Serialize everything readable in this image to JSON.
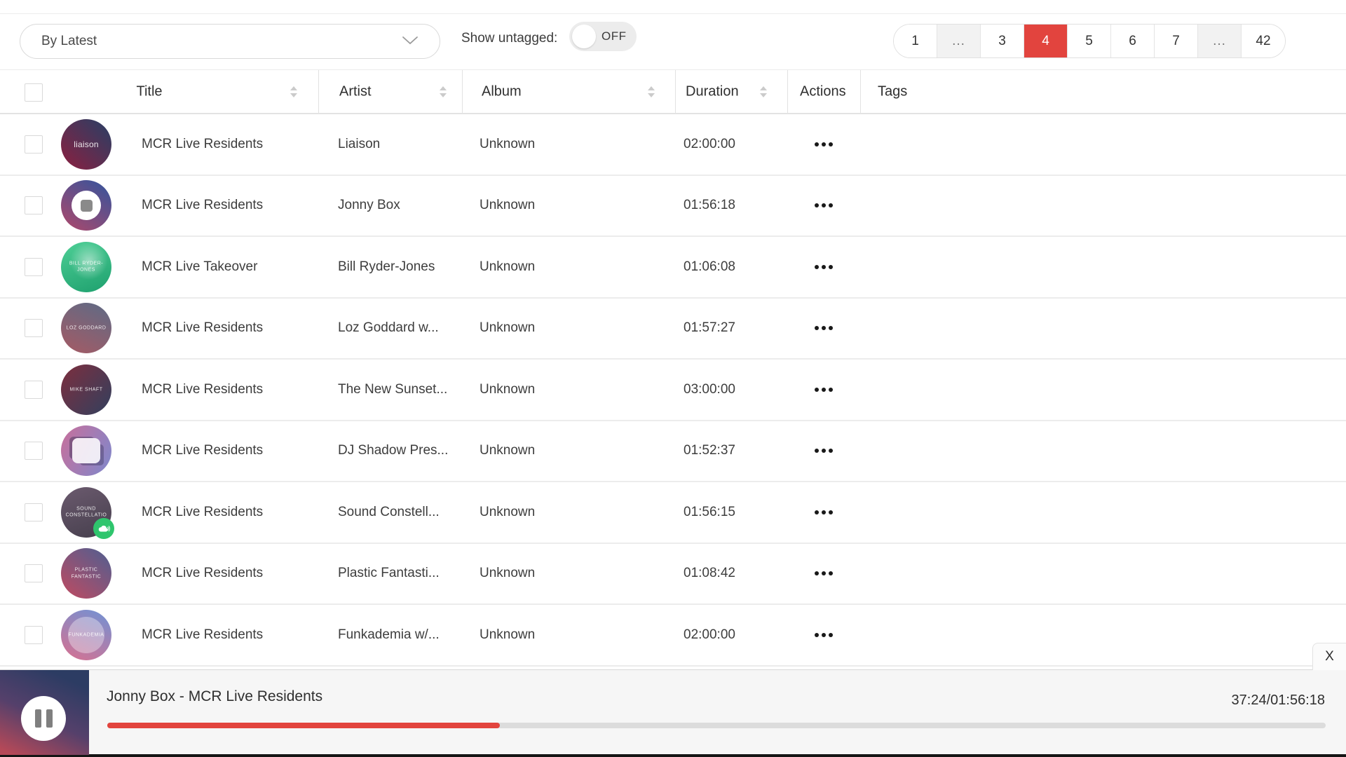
{
  "toolbar": {
    "sort": {
      "value": "By Latest"
    },
    "untagged": {
      "label": "Show untagged:",
      "state": "OFF"
    },
    "pagination": {
      "pages": [
        "1",
        "...",
        "3",
        "4",
        "5",
        "6",
        "7",
        "...",
        "42"
      ],
      "active": "4"
    }
  },
  "table": {
    "columns": [
      "Title",
      "Artist",
      "Album",
      "Duration",
      "Actions",
      "Tags"
    ],
    "sortable_columns": [
      "Title",
      "Artist",
      "Album",
      "Duration"
    ],
    "rows": [
      {
        "title": "MCR Live Residents",
        "artist": "Liaison",
        "album": "Unknown",
        "duration": "02:00:00",
        "art": {
          "label": "liaison",
          "label_large": true,
          "from": "#274066",
          "to": "#8c1f3f",
          "angle": 225
        }
      },
      {
        "title": "MCR Live Residents",
        "artist": "Jonny Box",
        "album": "Unknown",
        "duration": "01:56:18",
        "playing": true,
        "art": {
          "label": "",
          "from": "#31549e",
          "to": "#b0486a",
          "angle": 215
        }
      },
      {
        "title": "MCR Live Takeover",
        "artist": "Bill Ryder-Jones",
        "album": "Unknown",
        "duration": "01:06:08",
        "art": {
          "label": "BILL RYDER-JONES",
          "from": "#4ecf96",
          "to": "#1ea06e",
          "angle": 160,
          "highlight": true
        }
      },
      {
        "title": "MCR Live Residents",
        "artist": "Loz Goddard w...",
        "album": "Unknown",
        "duration": "01:57:27",
        "art": {
          "label": "LOZ GODDARD",
          "from": "#5d6b86",
          "to": "#a65a64",
          "angle": 205
        }
      },
      {
        "title": "MCR Live Residents",
        "artist": "The New Sunset...",
        "album": "Unknown",
        "duration": "03:00:00",
        "art": {
          "label": "MIKE SHAFT",
          "from": "#7d2e3e",
          "to": "#32405e",
          "angle": 130
        }
      },
      {
        "title": "MCR Live Residents",
        "artist": "DJ Shadow Pres...",
        "album": "Unknown",
        "duration": "01:52:37",
        "art": {
          "label": "",
          "from": "#c86f9b",
          "to": "#7e88cc",
          "angle": 115,
          "blob": true
        }
      },
      {
        "title": "MCR Live Residents",
        "artist": "Sound Constell...",
        "album": "Unknown",
        "duration": "01:56:15",
        "art": {
          "label": "SOUND CONSTELLATIO",
          "from": "#6b5a6e",
          "to": "#463f4d",
          "angle": 160,
          "badge": "soundcloud"
        }
      },
      {
        "title": "MCR Live Residents",
        "artist": "Plastic Fantasti...",
        "album": "Unknown",
        "duration": "01:08:42",
        "art": {
          "label": "PLASTIC FANTASTIC",
          "from": "#4e5f92",
          "to": "#c14a60",
          "angle": 220
        }
      },
      {
        "title": "MCR Live Residents",
        "artist": "Funkademia w/...",
        "album": "Unknown",
        "duration": "02:00:00",
        "art": {
          "label": "funkademia",
          "from": "#6f93d6",
          "to": "#d9708f",
          "angle": 205,
          "disc": true
        }
      }
    ]
  },
  "player": {
    "track_title": "Jonny Box - MCR Live Residents",
    "time": "37:24/01:56:18",
    "elapsed": "37:24",
    "total": "01:56:18",
    "progress_percent": 32.2,
    "close_label": "X"
  },
  "icons": {
    "dropdown_chevron": "chevron-down",
    "sort": "up-down-triangles",
    "row_actions": "ellipsis",
    "playing_overlay": "stop-square",
    "soundcloud_badge": "cloud",
    "player_button": "pause-bars"
  },
  "colors": {
    "accent_red": "#e2443e",
    "badge_green": "#2fc56d",
    "row_border": "#ececec"
  }
}
